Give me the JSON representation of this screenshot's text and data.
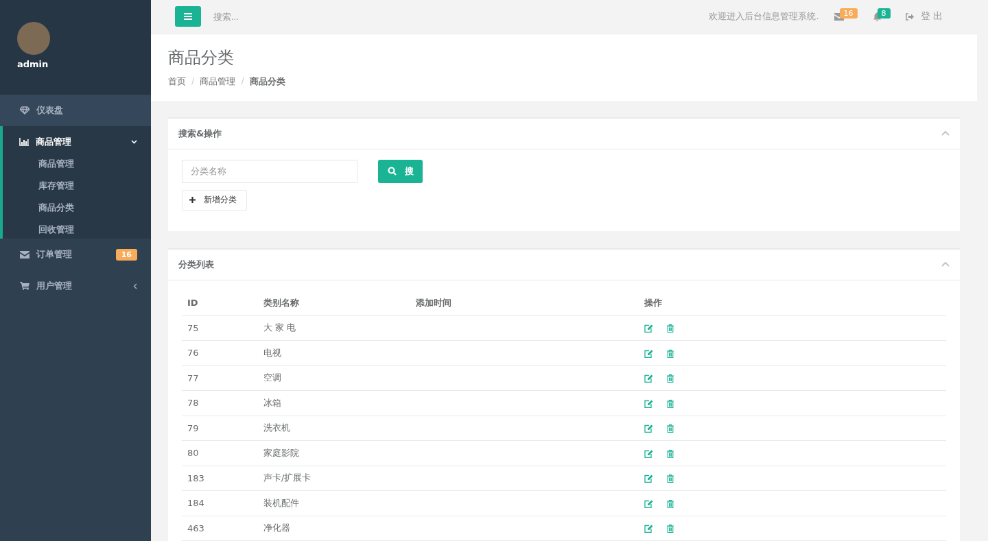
{
  "sidebar": {
    "user": {
      "name": "admin"
    },
    "items": [
      {
        "label": "仪表盘",
        "selected": false
      },
      {
        "label": "商品管理",
        "selected": true,
        "expanded": true,
        "children": [
          {
            "label": "商品管理"
          },
          {
            "label": "库存管理"
          },
          {
            "label": "商品分类"
          },
          {
            "label": "回收管理"
          }
        ]
      },
      {
        "label": "订单管理",
        "selected": false,
        "badge": "16"
      },
      {
        "label": "用户管理",
        "selected": false,
        "expanded": false
      }
    ]
  },
  "header": {
    "search": {
      "placeholder": "搜索..."
    },
    "welcome": "欢迎进入后台信息管理系统.",
    "mail_badge": "16",
    "bell_badge": "8",
    "logout": "登 出"
  },
  "page": {
    "title": "商品分类",
    "breadcrumb": [
      "首页",
      "商品管理",
      "商品分类"
    ],
    "breadcrumb_separator": "/"
  },
  "search_panel": {
    "title": "搜索&操作",
    "field": {
      "placeholder": "分类名称"
    },
    "search_button": "搜",
    "add_button": "新增分类"
  },
  "list_panel": {
    "title": "分类列表",
    "columns": [
      "ID",
      "类别名称",
      "添加时间",
      "操作"
    ],
    "rows": [
      {
        "id": "75",
        "name": "大 家 电"
      },
      {
        "id": "76",
        "name": "电视"
      },
      {
        "id": "77",
        "name": "空调"
      },
      {
        "id": "78",
        "name": "冰箱"
      },
      {
        "id": "79",
        "name": "洗衣机"
      },
      {
        "id": "80",
        "name": "家庭影院"
      },
      {
        "id": "183",
        "name": "声卡/扩展卡"
      },
      {
        "id": "184",
        "name": "装机配件"
      },
      {
        "id": "463",
        "name": "净化器"
      }
    ]
  }
}
